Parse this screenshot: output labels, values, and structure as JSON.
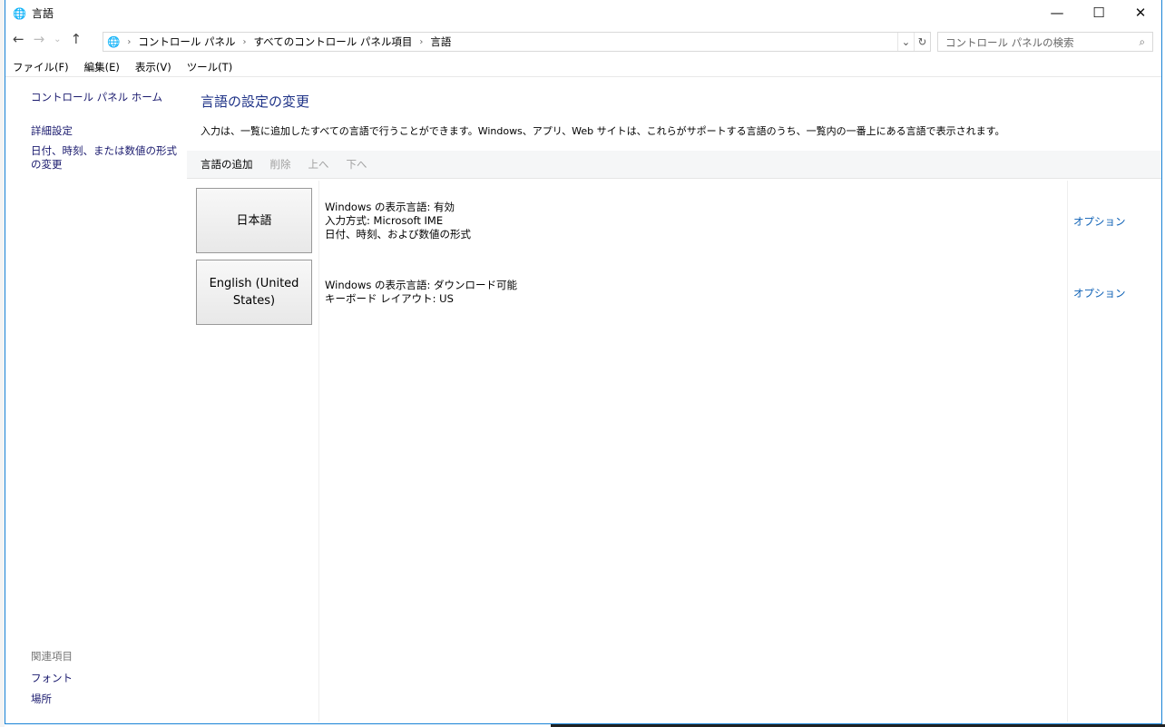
{
  "window": {
    "title": "言語",
    "minimize": "—",
    "maximize": "☐",
    "close": "✕"
  },
  "address": {
    "crumbs": [
      "コントロール パネル",
      "すべてのコントロール パネル項目",
      "言語"
    ],
    "search_placeholder": "コントロール パネルの検索"
  },
  "menu": [
    "ファイル(F)",
    "編集(E)",
    "表示(V)",
    "ツール(T)"
  ],
  "sidebar": {
    "home": "コントロール パネル ホーム",
    "items": [
      "詳細設定",
      "日付、時刻、または数値の形式の変更"
    ],
    "related_heading": "関連項目",
    "related": [
      "フォント",
      "場所"
    ]
  },
  "main": {
    "title": "言語の設定の変更",
    "description": "入力は、一覧に追加したすべての言語で行うことができます。Windows、アプリ、Web サイトは、これらがサポートする言語のうち、一覧内の一番上にある言語で表示されます。",
    "toolbar": {
      "add": "言語の追加",
      "remove": "削除",
      "up": "上へ",
      "down": "下へ"
    },
    "languages": [
      {
        "name": "日本語",
        "lines": [
          "Windows の表示言語: 有効",
          "入力方式: Microsoft IME",
          "日付、時刻、および数値の形式"
        ],
        "options": "オプション"
      },
      {
        "name": "English (United States)",
        "lines": [
          "Windows の表示言語: ダウンロード可能",
          "キーボード レイアウト: US"
        ],
        "options": "オプション"
      }
    ]
  }
}
